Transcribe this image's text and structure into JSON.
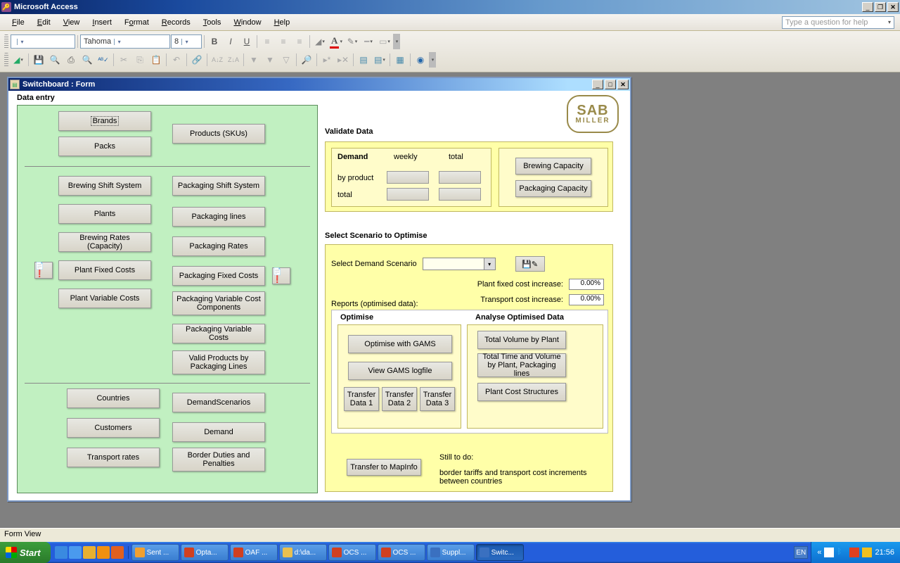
{
  "app": {
    "title": "Microsoft Access"
  },
  "menu": {
    "file": "File",
    "edit": "Edit",
    "view": "View",
    "insert": "Insert",
    "format": "Format",
    "records": "Records",
    "tools": "Tools",
    "window": "Window",
    "help": "Help"
  },
  "help_placeholder": "Type a question for help",
  "toolbar": {
    "font": "Tahoma",
    "size": "8"
  },
  "form": {
    "title": "Switchboard : Form",
    "data_entry": "Data entry",
    "buttons": {
      "brands": "Brands",
      "packs": "Packs",
      "products": "Products (SKUs)",
      "brewing_shift": "Brewing Shift System",
      "plants": "Plants",
      "brewing_rates": "Brewing Rates (Capacity)",
      "plant_fixed": "Plant Fixed Costs",
      "plant_var": "Plant Variable Costs",
      "pack_shift": "Packaging Shift System",
      "pack_lines": "Packaging lines",
      "pack_rates": "Packaging Rates",
      "pack_fixed": "Packaging Fixed Costs",
      "pack_var_comp": "Packaging Variable Cost Components",
      "pack_var": "Packaging Variable Costs",
      "valid_prod": "Valid Products by Packaging Lines",
      "countries": "Countries",
      "customers": "Customers",
      "transport": "Transport rates",
      "dem_scen": "DemandScenarios",
      "demand": "Demand",
      "border": "Border Duties and Penalties"
    },
    "validate": {
      "label": "Validate Data",
      "demand": "Demand",
      "weekly": "weekly",
      "total_h": "total",
      "by_product": "by product",
      "total": "total",
      "brewing_cap": "Brewing Capacity",
      "packaging_cap": "Packaging Capacity"
    },
    "scenario": {
      "label": "Select Scenario to Optimise",
      "select_demand": "Select Demand Scenario",
      "plant_fixed_inc": "Plant fixed cost increase:",
      "transport_inc": "Transport cost increase:",
      "pct": "0.00%",
      "reports": "Reports (optimised data):",
      "optimise": "Optimise",
      "analyse": "Analyse Optimised Data",
      "opt_gams": "Optimise with GAMS",
      "view_log": "View GAMS logfile",
      "td1": "Transfer Data  1",
      "td2": "Transfer Data  2",
      "td3": "Transfer Data  3",
      "total_vol": "Total Volume by Plant",
      "total_time": "Total Time and Volume by Plant, Packaging lines",
      "plant_cost": "Plant Cost Structures",
      "transfer_map": "Transfer to MapInfo",
      "todo_h": "Still to do:",
      "todo_t": "border tariffs and transport cost increments between countries"
    },
    "logo": {
      "big": "SAB",
      "small": "MILLER"
    }
  },
  "status": "Form View",
  "taskbar": {
    "start": "Start",
    "items": [
      "Sent ...",
      "Opta...",
      "OAF ...",
      "d:\\da...",
      "OCS ...",
      "OCS ...",
      "Suppl...",
      "Switc..."
    ],
    "lang": "EN",
    "time": "21:56"
  }
}
